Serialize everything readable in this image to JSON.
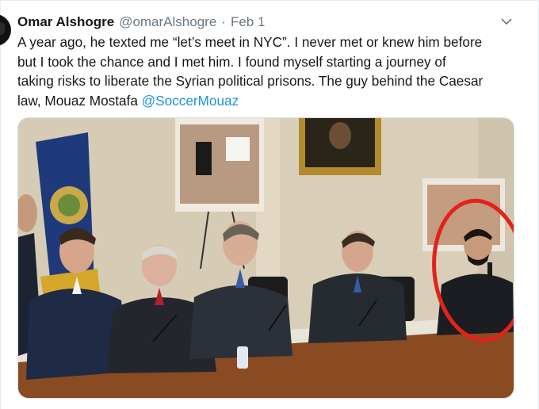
{
  "tweet": {
    "display_name": "Omar Alshogre",
    "handle": "@omarAlshogre",
    "separator": "·",
    "date": "Feb 1",
    "lines": [
      "A year ago, he texted me “let’s meet in NYC”. I never met or knew him before",
      "but I took the chance and I met him. I found myself starting a journey of",
      "taking risks to liberate the Syrian political prisons. The guy behind the Caesar",
      "law, Mouaz Mostafa "
    ],
    "mention": "@SoccerMouaz"
  },
  "icons": {
    "menu": "chevron-down-icon",
    "avatar": "avatar"
  },
  "colors": {
    "accent": "#1b95e0",
    "muted": "#657786",
    "text": "#14171a",
    "highlight_circle": "#e2231a"
  },
  "photo": {
    "description_visible_text": "",
    "subjects_count": 6
  }
}
